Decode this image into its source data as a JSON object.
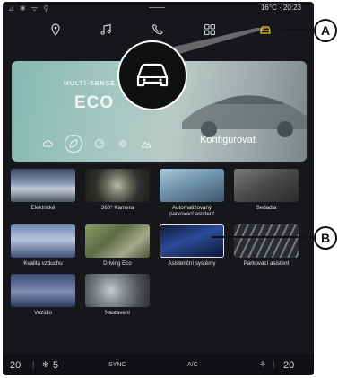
{
  "status": {
    "left": "⊿ ✱ ᯤ ⚲",
    "right": "16°C · 20:23"
  },
  "navbar": {
    "items": [
      {
        "icon": "map-pin-icon"
      },
      {
        "icon": "music-note-icon"
      },
      {
        "icon": "phone-icon"
      },
      {
        "icon": "apps-grid-icon"
      },
      {
        "icon": "car-icon",
        "active": true
      }
    ]
  },
  "banner": {
    "subtitle": "MULTI-SENSE",
    "title": "ECO",
    "configure": "Konfigurovat"
  },
  "tiles": [
    {
      "label": "Elektrické"
    },
    {
      "label": "360° Kamera"
    },
    {
      "label": "Automatizovaný parkovací asistent"
    },
    {
      "label": "Sedadla"
    },
    {
      "label": "Kvalita vzduchu"
    },
    {
      "label": "Driving Eco"
    },
    {
      "label": "Asistenční systémy"
    },
    {
      "label": "Parkovací asistent"
    },
    {
      "label": "Vozidlo"
    },
    {
      "label": "Nastavení"
    }
  ],
  "bottombar": {
    "temp_left": "20",
    "fan": "5",
    "sync": "SYNC",
    "ac": "A/C",
    "temp_right": "20"
  },
  "callouts": {
    "a": "A",
    "b": "B"
  },
  "colors": {
    "accent": "#f0c12e",
    "background": "#15171b"
  }
}
